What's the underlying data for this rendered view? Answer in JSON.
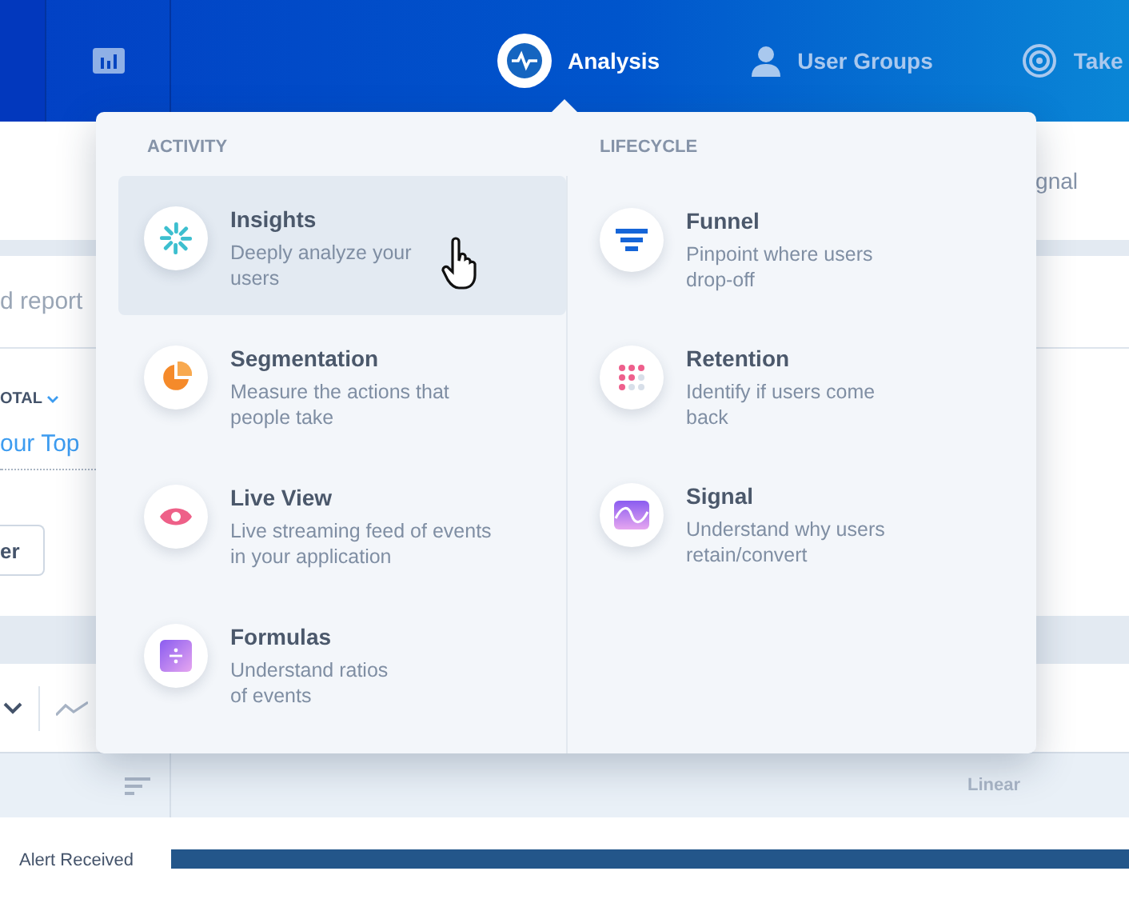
{
  "nav": {
    "items": [
      {
        "label": "Analysis",
        "selected": true,
        "kind": "pulse"
      },
      {
        "label": "User Groups",
        "selected": false,
        "kind": "person"
      },
      {
        "label": "Take",
        "selected": false,
        "kind": "target"
      }
    ]
  },
  "page": {
    "tab_text": "gnal",
    "search_text": "d report",
    "total_label": "OTAL",
    "top_link": "our Top",
    "button_label": "er",
    "scale_label": "Linear",
    "row_label": "Alert Received"
  },
  "menu": {
    "columns": [
      {
        "heading": "ACTIVITY",
        "items": [
          {
            "title": "Insights",
            "description_lines": [
              "Deeply analyze your",
              "users"
            ],
            "selected": true,
            "kind": "insights"
          },
          {
            "title": "Segmentation",
            "description_lines": [
              "Measure the actions that",
              "people take"
            ],
            "selected": false,
            "kind": "segmentation"
          },
          {
            "title": "Live View",
            "description_lines": [
              "Live streaming feed of events",
              "in your application"
            ],
            "selected": false,
            "kind": "liveview"
          },
          {
            "title": "Formulas",
            "description_lines": [
              "Understand ratios",
              "of events"
            ],
            "selected": false,
            "kind": "formulas"
          }
        ]
      },
      {
        "heading": "LIFECYCLE",
        "items": [
          {
            "title": "Funnel",
            "description_lines": [
              "Pinpoint where users",
              "drop-off"
            ],
            "selected": false,
            "kind": "funnel"
          },
          {
            "title": "Retention",
            "description_lines": [
              "Identify if users come",
              "back"
            ],
            "selected": false,
            "kind": "retention"
          },
          {
            "title": "Signal",
            "description_lines": [
              "Understand why users",
              "retain/convert"
            ],
            "selected": false,
            "kind": "signal"
          }
        ]
      }
    ]
  }
}
